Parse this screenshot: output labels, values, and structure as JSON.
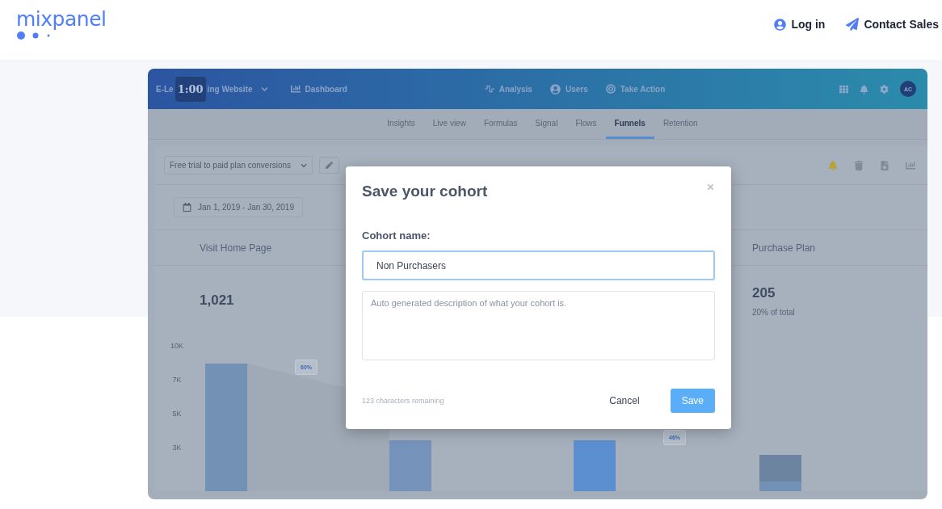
{
  "site_nav": {
    "logo": "mixpanel",
    "links": [
      {
        "kind": "login",
        "label": "Log in"
      },
      {
        "kind": "contact",
        "label": "Contact Sales"
      }
    ]
  },
  "app": {
    "project_parts": [
      "E-Le",
      "ing Website"
    ],
    "video_time": "1:00",
    "top_links": [
      {
        "kind": "dashboard",
        "label": "Dashboard"
      }
    ],
    "center_links": [
      {
        "kind": "analysis",
        "label": "Analysis"
      },
      {
        "kind": "users",
        "label": "Users"
      },
      {
        "kind": "action",
        "label": "Take Action"
      }
    ],
    "avatar": "AC",
    "tabs": [
      {
        "label": "Insights",
        "selected": false
      },
      {
        "label": "Live view",
        "selected": false
      },
      {
        "label": "Formulas",
        "selected": false
      },
      {
        "label": "Signal",
        "selected": false
      },
      {
        "label": "Flows",
        "selected": false
      },
      {
        "label": "Funnels",
        "selected": true
      },
      {
        "label": "Retention",
        "selected": false
      }
    ],
    "report_select": "Free trial to paid plan conversions",
    "date_range": "Jan 1, 2019 - Jan 30, 2019",
    "steps": [
      {
        "name": "Visit Home Page",
        "count": "1,021"
      },
      {
        "name": "Purchase Plan",
        "count": "205",
        "share": "20% of total"
      }
    ],
    "y_axis": [
      "10K",
      "7K",
      "5K",
      "3K"
    ],
    "conversion_tags": [
      "60%",
      "46%"
    ]
  },
  "modal": {
    "title": "Save your cohort",
    "field_label": "Cohort name:",
    "name_value": "Non Purchasers",
    "description_placeholder": "Auto generated description of what your cohort is.",
    "remaining": "123 characters remaining",
    "buttons": [
      {
        "kind": "secondary",
        "label": "Cancel"
      },
      {
        "kind": "primary",
        "label": "Save"
      }
    ]
  }
}
